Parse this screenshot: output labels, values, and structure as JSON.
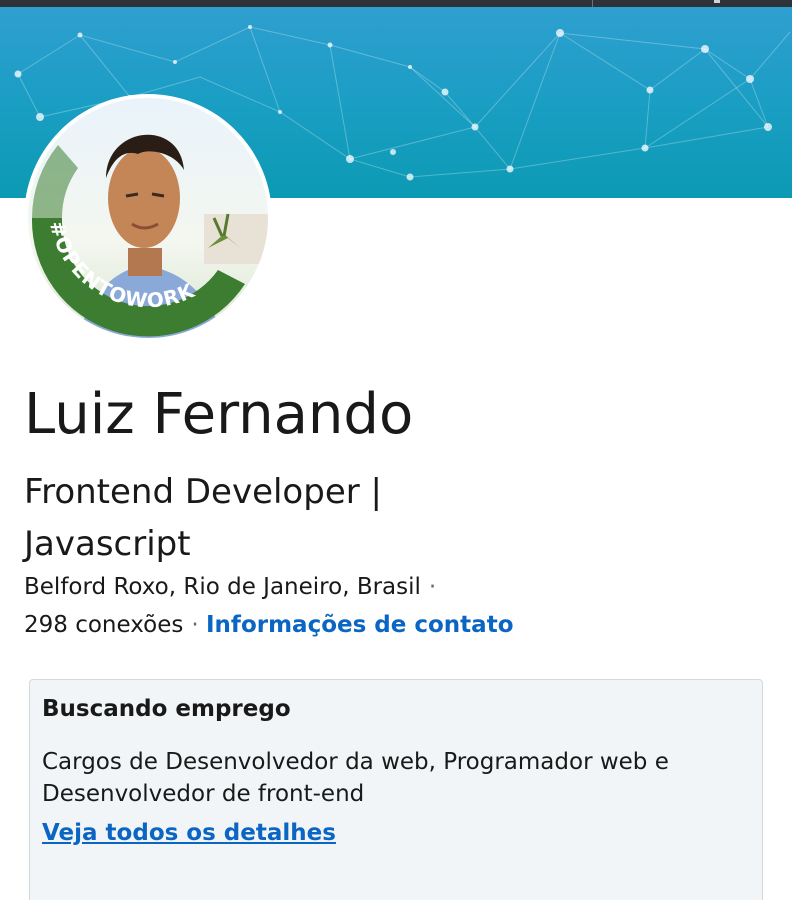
{
  "profile": {
    "name": "Luiz Fernando",
    "headline": "Frontend Developer | Javascript",
    "location": "Belford Roxo, Rio de Janeiro, Brasil",
    "separator": "·",
    "connections": "298 conexões",
    "contact_link": "Informações de contato",
    "badge": "#OPENTOWORK"
  },
  "open_to_work_card": {
    "title": "Buscando emprego",
    "description": "Cargos de Desenvolvedor da web, Programador web e Desenvolvedor de front-end",
    "link": "Veja todos os detalhes"
  },
  "colors": {
    "accent": "#0a66c2",
    "banner": "#1a9ec4",
    "badge_green": "#3c7d31"
  }
}
